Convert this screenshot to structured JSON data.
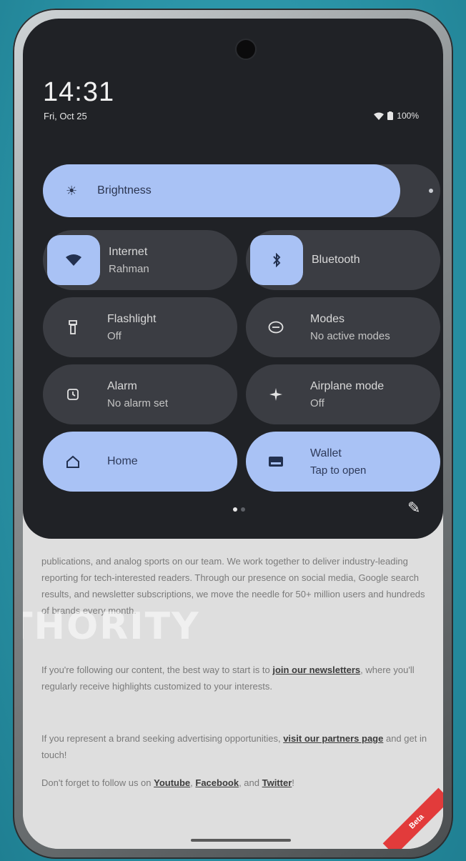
{
  "status_bar": {
    "time": "14:31",
    "date": "Fri, Oct 25",
    "battery": "100%"
  },
  "brightness": {
    "label": "Brightness",
    "level": 0.9
  },
  "tiles": [
    {
      "title": "Internet",
      "subtitle": "Rahman",
      "icon": "wifi-icon",
      "state": "icon-on"
    },
    {
      "title": "Bluetooth",
      "subtitle": "",
      "icon": "bluetooth-icon",
      "state": "icon-on"
    },
    {
      "title": "Flashlight",
      "subtitle": "Off",
      "icon": "flashlight-icon",
      "state": "off"
    },
    {
      "title": "Modes",
      "subtitle": "No active modes",
      "icon": "modes-icon",
      "state": "off"
    },
    {
      "title": "Alarm",
      "subtitle": "No alarm set",
      "icon": "alarm-icon",
      "state": "off"
    },
    {
      "title": "Airplane mode",
      "subtitle": "Off",
      "icon": "airplane-icon",
      "state": "off"
    },
    {
      "title": "Home",
      "subtitle": "",
      "icon": "home-icon",
      "state": "active"
    },
    {
      "title": "Wallet",
      "subtitle": "Tap to open",
      "icon": "wallet-icon",
      "state": "active"
    }
  ],
  "page_indicator": {
    "current": 1,
    "total": 2
  },
  "article": {
    "p1": "publications, and analog sports on our team. We work together to deliver industry-leading reporting for tech-interested readers. Through our presence on social media, Google search results, and newsletter subscriptions, we move the needle for 50+ million users and hundreds of brands every month.",
    "p2_pre": "If you're ",
    "p2_mid": "following our content, the best way to start is to ",
    "p2_link": "join our newsletters",
    "p2_post": ", where you'll regularly receive highlights customized to your interests.",
    "p3_pre": "If you represent a brand seeking advertising opportunities, ",
    "p3_link": "visit our partners page",
    "p3_post": " and get in touch!",
    "p4_pre": "Don't forget to follow us on ",
    "p4_l1": "Youtube",
    "p4_sep1": ", ",
    "p4_l2": "Facebook",
    "p4_sep2": ", and ",
    "p4_l3": "Twitter",
    "p4_post": "!",
    "watermark": "THORITY",
    "badge": "Beta"
  },
  "colors": {
    "accent": "#a9c2f5",
    "shade": "#202226",
    "tile": "#3b3d43"
  }
}
